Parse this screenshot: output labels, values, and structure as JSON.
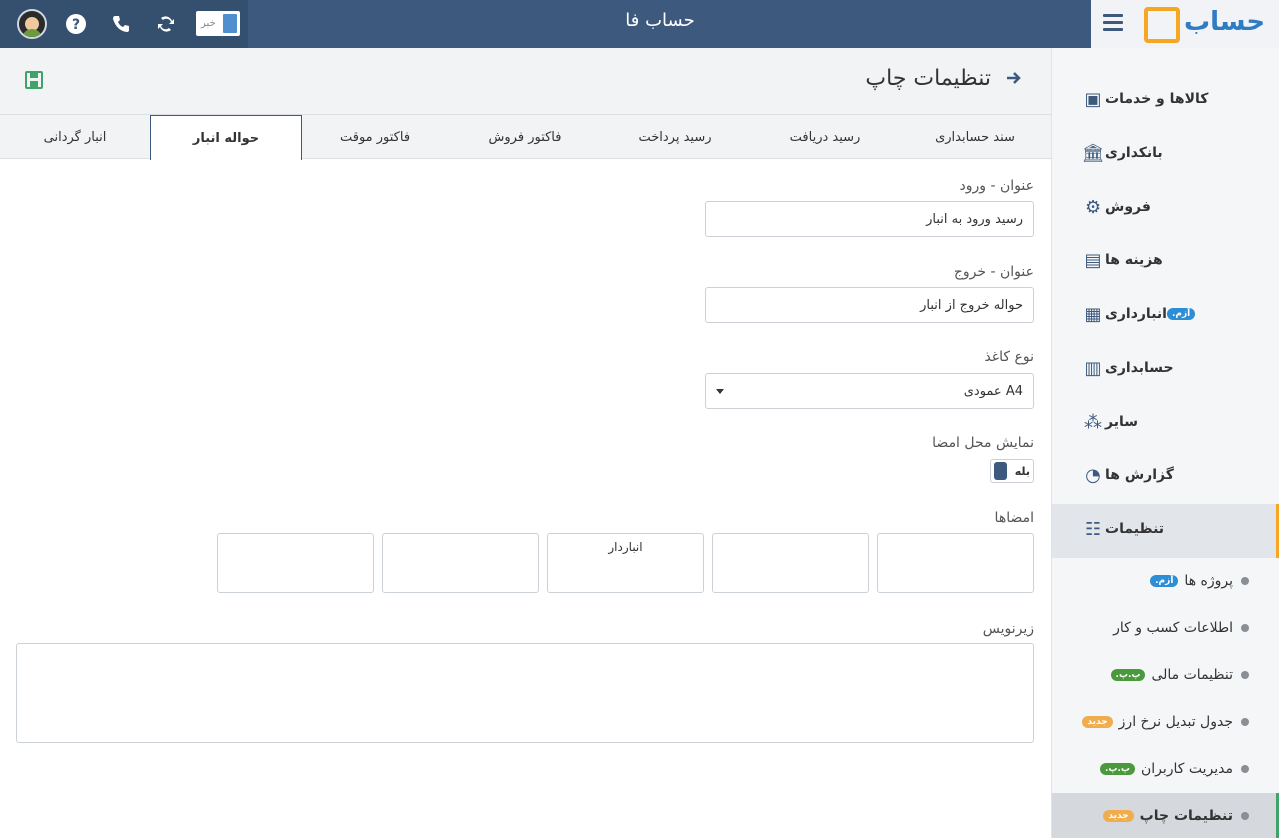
{
  "app": {
    "title": "حساب فا",
    "logo_text": "حساب"
  },
  "topbar": {
    "news_label": "خبر"
  },
  "page": {
    "title": "تنظیمات چاپ"
  },
  "tabs": [
    {
      "label": "سند حسابداری"
    },
    {
      "label": "رسید دریافت"
    },
    {
      "label": "رسید پرداخت"
    },
    {
      "label": "فاکتور فروش"
    },
    {
      "label": "فاکتور موقت"
    },
    {
      "label": "حواله انبار"
    },
    {
      "label": "انبار گردانی"
    }
  ],
  "form": {
    "entry_title_label": "عنوان - ورود",
    "entry_title_value": "رسید ورود به انبار",
    "exit_title_label": "عنوان - خروج",
    "exit_title_value": "حواله خروج از انبار",
    "paper_label": "نوع کاغذ",
    "paper_value": "A4 عمودی",
    "show_sign_label": "نمایش محل امضا",
    "show_sign_value": "بله",
    "signatures_label": "امضاها",
    "signatures": [
      "",
      "",
      "انباردار",
      "",
      "",
      ""
    ],
    "footer_label": "زیرنویس",
    "footer_value": ""
  },
  "sidebar": {
    "items": [
      {
        "label": "کالاها و خدمات",
        "icon": "box-icon"
      },
      {
        "label": "بانکداری",
        "icon": "bank-icon"
      },
      {
        "label": "فروش",
        "icon": "sales-icon"
      },
      {
        "label": "هزینه ها",
        "icon": "wallet-icon"
      },
      {
        "label": "انبارداری",
        "icon": "warehouse-icon",
        "badge": "آزم."
      },
      {
        "label": "حسابداری",
        "icon": "abacus-icon"
      },
      {
        "label": "سایر",
        "icon": "misc-icon"
      },
      {
        "label": "گزارش ها",
        "icon": "report-icon"
      },
      {
        "label": "تنظیمات",
        "icon": "sliders-icon"
      }
    ],
    "subitems": [
      {
        "label": "پروژه ها",
        "badge": "آزم."
      },
      {
        "label": "اطلاعات کسب و کار"
      },
      {
        "label": "تنظیمات مالی",
        "badge": "پ.پ."
      },
      {
        "label": "جدول تبدیل نرخ ارز",
        "badge": "جدید"
      },
      {
        "label": "مدیریت کاربران",
        "badge": "پ.پ."
      },
      {
        "label": "تنظیمات چاپ",
        "badge": "جدید"
      }
    ]
  },
  "colors": {
    "primary": "#3d5a7e",
    "accent": "#f5a623",
    "success": "#3fa36b"
  }
}
